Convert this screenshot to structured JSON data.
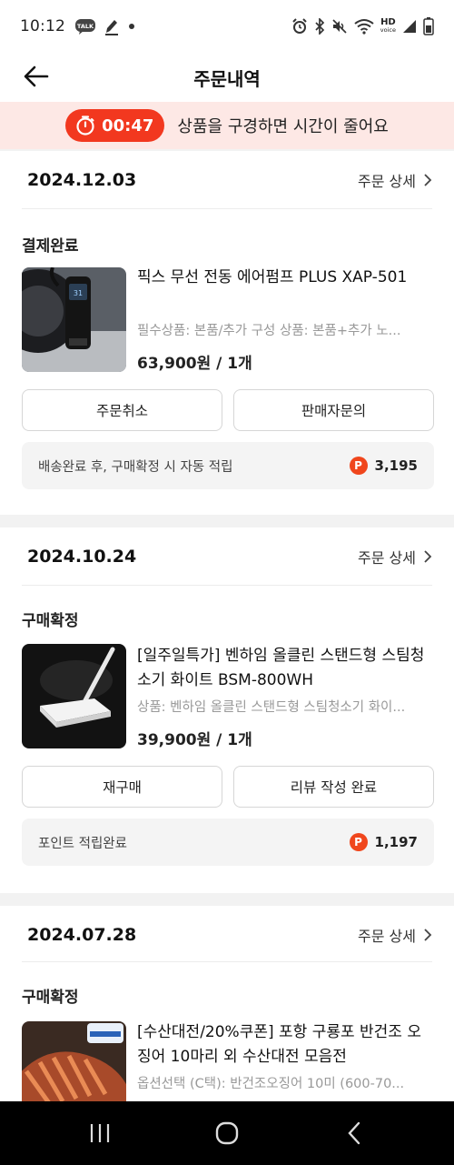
{
  "status_bar": {
    "time": "10:12",
    "left_icons": [
      "talk-badge-icon",
      "edit-icon",
      "dot-icon"
    ],
    "right_icons": [
      "alarm-icon",
      "bluetooth-icon",
      "mute-icon",
      "wifi-icon",
      "hd-voice-icon",
      "signal-icon",
      "battery-icon"
    ],
    "hd_label": "HD",
    "voice_label": "voice",
    "talk_label": "TALK"
  },
  "header": {
    "title": "주문내역"
  },
  "timer_banner": {
    "time": "00:47",
    "message": "상품을 구경하면 시간이 줄어요",
    "color": "#f2381f"
  },
  "orders": [
    {
      "date": "2024.12.03",
      "detail_label": "주문 상세",
      "status": "결제완료",
      "product_name": "픽스 무선 전동 에어펌프 PLUS XAP-501",
      "option": "필수상품: 본품/추가 구성 상품: 본품+추가 노...",
      "price": "63,900원 / 1개",
      "buttons": [
        "주문취소",
        "판매자문의"
      ],
      "point_text": "배송완료 후, 구매확정 시 자동 적립",
      "point_value": "3,195"
    },
    {
      "date": "2024.10.24",
      "detail_label": "주문 상세",
      "status": "구매확정",
      "product_name": "[일주일특가] 벤하임 올클린 스탠드형 스팀청소기 화이트 BSM-800WH",
      "option": "상품: 벤하임 올클린 스탠드형 스팀청소기 화이...",
      "price": "39,900원 / 1개",
      "buttons": [
        "재구매",
        "리뷰 작성 완료"
      ],
      "point_text": "포인트 적립완료",
      "point_value": "1,197"
    },
    {
      "date": "2024.07.28",
      "detail_label": "주문 상세",
      "status": "구매확정",
      "product_name": "[수산대전/20%쿠폰] 포항 구룡포 반건조 오징어 10마리 외 수산대전 모음전",
      "option": "옵션선택 (C택): 반건조오징어 10미 (600-70..."
    }
  ],
  "point_icon_letter": "P",
  "nav_bar": [
    "recent-apps-icon",
    "home-icon",
    "back-nav-icon"
  ]
}
